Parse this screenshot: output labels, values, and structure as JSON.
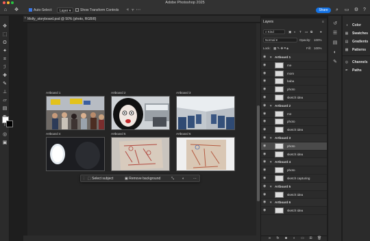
{
  "app": {
    "title": "Adobe Photoshop 2025"
  },
  "options": {
    "auto_select_label": "Auto-Select:",
    "auto_select_value": "Layer",
    "show_transform_label": "Show Transform Controls",
    "share_label": "Share"
  },
  "document": {
    "tab_title": "Molly_storyboard.psd @ 50% (photo, RGB/8)"
  },
  "artboards": [
    {
      "label": "Artboard 1",
      "content": "airport crowd photo"
    },
    {
      "label": "Artboard 2",
      "content": "face sketch over gate photo"
    },
    {
      "label": "Artboard 3",
      "content": "airplane cabin photo"
    },
    {
      "label": "Artboard 4",
      "content": "airplane window photo"
    },
    {
      "label": "Artboard 5",
      "content": "storyboard sketch"
    },
    {
      "label": "Artboard 6",
      "content": "storyboard sketch"
    }
  ],
  "context_bar": {
    "select_subject": "Select subject",
    "remove_background": "Remove background"
  },
  "layers_panel": {
    "title": "Layers",
    "kind_filter": "Kind",
    "blend_mode": "Normal",
    "opacity_label": "Opacity:",
    "opacity_value": "100%",
    "lock_label": "Lock:",
    "fill_label": "Fill:",
    "fill_value": "100%",
    "rows": [
      {
        "type": "group",
        "name": "Artboard 1"
      },
      {
        "type": "layer",
        "name": "me"
      },
      {
        "type": "layer",
        "name": "mom"
      },
      {
        "type": "layer",
        "name": "baba"
      },
      {
        "type": "layer",
        "name": "photo"
      },
      {
        "type": "layer",
        "name": "sketch idea"
      },
      {
        "type": "group",
        "name": "Artboard 2"
      },
      {
        "type": "layer",
        "name": "me"
      },
      {
        "type": "layer",
        "name": "photo"
      },
      {
        "type": "layer",
        "name": "sketch idea"
      },
      {
        "type": "group",
        "name": "Artboard 3"
      },
      {
        "type": "layer",
        "name": "photo",
        "selected": true
      },
      {
        "type": "layer",
        "name": "sketch idea"
      },
      {
        "type": "group",
        "name": "Artboard 4"
      },
      {
        "type": "layer",
        "name": "photo"
      },
      {
        "type": "layer",
        "name": "sketch capturing"
      },
      {
        "type": "group",
        "name": "Artboard 5"
      },
      {
        "type": "layer",
        "name": "sketch idea"
      },
      {
        "type": "group",
        "name": "Artboard 6"
      },
      {
        "type": "layer",
        "name": "sketch idea"
      }
    ]
  },
  "right_panels": {
    "items": [
      "Color",
      "Swatches",
      "Gradients",
      "Patterns",
      "Channels",
      "Paths"
    ]
  },
  "colors": {
    "accent": "#1473e6",
    "foreground": "#ffffff",
    "background": "#000000"
  }
}
